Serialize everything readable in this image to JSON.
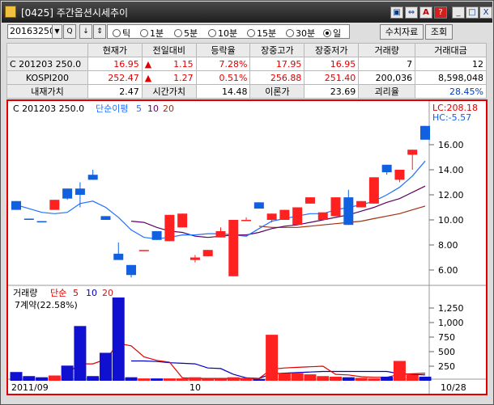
{
  "window": {
    "title": "[0425] 주간옵션시세추이",
    "buttons": [
      "▣",
      "⇔",
      "A",
      "?",
      "_",
      "□",
      "X"
    ]
  },
  "toolbar": {
    "code": "20163250",
    "combo_arrow": "▼",
    "search_icon": "Q",
    "pick_icon": "↓",
    "spin_icon": "⇕",
    "periods": [
      "틱",
      "1분",
      "5분",
      "10분",
      "15분",
      "30분",
      "일"
    ],
    "selected_period": "일",
    "numeric_button": "수치자료",
    "query_button": "조회"
  },
  "info": {
    "headers": [
      "",
      "현재가",
      "전일대비",
      "등락율",
      "장중고가",
      "장중저가",
      "거래량",
      "거래대금"
    ],
    "rows": [
      {
        "name": "C 201203 250.0",
        "price": "16.95",
        "arrow": "▲",
        "change": "1.15",
        "rate": "7.28%",
        "high": "17.95",
        "low": "16.95",
        "volume": "7",
        "amount": "12"
      },
      {
        "name": "KOSPI200",
        "price": "252.47",
        "arrow": "▲",
        "change": "1.27",
        "rate": "0.51%",
        "high": "256.88",
        "low": "251.40",
        "volume": "200,036",
        "amount": "8,598,048"
      }
    ],
    "row3": {
      "l1": "내재가치",
      "v1": "2.47",
      "l2": "시간가치",
      "v2": "14.48",
      "l3": "이론가",
      "v3": "23.69",
      "l4": "괴리율",
      "v4": "28.45%"
    }
  },
  "chart_labels": {
    "price_name": "C 201203 250.0",
    "ma_label": "단순이평",
    "ma5": "5",
    "ma10": "10",
    "ma20": "20",
    "lc": "LC:208.18",
    "hc": "HC:-5.57",
    "vol_label": "거래량",
    "vol_ma_label": "단순",
    "contracts": "7계약(22.58%)",
    "x_start": "2011/09",
    "x_mid": "10",
    "x_end": "10/28"
  },
  "chart_data": {
    "type": "candlestick",
    "y_ticks": [
      "16.00",
      "14.00",
      "12.00",
      "10.00",
      "8.00",
      "6.00"
    ],
    "vol_ticks": [
      "1,250",
      "1,000",
      "750",
      "500",
      "250"
    ],
    "colors": {
      "up": "#ff2020",
      "down": "#1060e0",
      "ma5": "#2070ff",
      "ma10": "#600060",
      "ma20": "#a03010"
    },
    "candles": [
      {
        "o": 11.5,
        "c": 10.8,
        "h": 11.5,
        "l": 10.8
      },
      {
        "o": 10.1,
        "c": 10.0,
        "h": 10.1,
        "l": 10.0
      },
      {
        "o": 9.9,
        "c": 9.8,
        "h": 9.9,
        "l": 9.8
      },
      {
        "o": 10.8,
        "c": 11.6,
        "h": 11.6,
        "l": 10.8
      },
      {
        "o": 12.5,
        "c": 11.7,
        "h": 12.5,
        "l": 11.6
      },
      {
        "o": 12.5,
        "c": 12.0,
        "h": 13.0,
        "l": 11.0
      },
      {
        "o": 13.6,
        "c": 13.2,
        "h": 14.0,
        "l": 13.2
      },
      {
        "o": 10.3,
        "c": 10.0,
        "h": 10.3,
        "l": 10.0
      },
      {
        "o": 7.3,
        "c": 6.8,
        "h": 8.2,
        "l": 6.8
      },
      {
        "o": 6.4,
        "c": 5.6,
        "h": 6.4,
        "l": 5.4
      },
      {
        "o": 7.6,
        "c": 7.6,
        "h": 7.6,
        "l": 7.6
      },
      {
        "o": 9.1,
        "c": 8.4,
        "h": 9.1,
        "l": 8.4
      },
      {
        "o": 8.3,
        "c": 10.4,
        "h": 10.4,
        "l": 8.3
      },
      {
        "o": 9.4,
        "c": 10.5,
        "h": 10.5,
        "l": 9.4
      },
      {
        "o": 6.8,
        "c": 7.0,
        "h": 7.2,
        "l": 6.6
      },
      {
        "o": 7.1,
        "c": 7.6,
        "h": 7.6,
        "l": 7.1
      },
      {
        "o": 8.6,
        "c": 9.1,
        "h": 9.4,
        "l": 8.6
      },
      {
        "o": 5.5,
        "c": 10.0,
        "h": 10.0,
        "l": 5.5
      },
      {
        "o": 10.0,
        "c": 10.0,
        "h": 10.2,
        "l": 10.0
      },
      {
        "o": 11.4,
        "c": 10.9,
        "h": 11.4,
        "l": 10.9
      },
      {
        "o": 10.0,
        "c": 10.5,
        "h": 10.5,
        "l": 9.8
      },
      {
        "o": 10.0,
        "c": 10.8,
        "h": 10.8,
        "l": 10.0
      },
      {
        "o": 9.6,
        "c": 11.0,
        "h": 11.0,
        "l": 9.6
      },
      {
        "o": 11.3,
        "c": 11.8,
        "h": 11.8,
        "l": 11.3
      },
      {
        "o": 10.0,
        "c": 10.6,
        "h": 10.6,
        "l": 10.0
      },
      {
        "o": 10.3,
        "c": 11.8,
        "h": 11.8,
        "l": 10.3
      },
      {
        "o": 11.8,
        "c": 9.6,
        "h": 12.4,
        "l": 9.6
      },
      {
        "o": 11.0,
        "c": 11.5,
        "h": 11.5,
        "l": 11.0
      },
      {
        "o": 11.3,
        "c": 13.4,
        "h": 13.4,
        "l": 11.3
      },
      {
        "o": 14.4,
        "c": 13.8,
        "h": 14.4,
        "l": 13.6
      },
      {
        "o": 13.2,
        "c": 14.0,
        "h": 14.0,
        "l": 13.0
      },
      {
        "o": 15.2,
        "c": 15.6,
        "h": 15.6,
        "l": 14.0
      },
      {
        "o": 17.5,
        "c": 16.4,
        "h": 17.5,
        "l": 16.4
      }
    ],
    "ma5": [
      11.2,
      10.9,
      10.6,
      10.5,
      10.6,
      11.3,
      11.5,
      11.0,
      10.2,
      9.2,
      8.6,
      8.5,
      8.6,
      8.8,
      8.8,
      8.9,
      8.9,
      8.8,
      8.7,
      9.3,
      9.9,
      10.1,
      10.3,
      10.5,
      10.5,
      10.8,
      11.0,
      11.2,
      11.5,
      12.0,
      12.6,
      13.5,
      14.7
    ],
    "ma10": [
      null,
      null,
      null,
      null,
      null,
      null,
      null,
      null,
      null,
      9.9,
      9.8,
      9.4,
      9.1,
      9.0,
      8.7,
      8.6,
      8.7,
      8.8,
      8.8,
      9.0,
      9.3,
      9.5,
      9.6,
      9.8,
      10.0,
      10.2,
      10.4,
      10.7,
      11.0,
      11.4,
      11.7,
      12.2,
      12.7
    ],
    "ma20": [
      null,
      null,
      null,
      null,
      null,
      null,
      null,
      null,
      null,
      null,
      null,
      null,
      null,
      null,
      null,
      null,
      null,
      null,
      null,
      9.5,
      9.4,
      9.4,
      9.4,
      9.5,
      9.6,
      9.7,
      9.8,
      9.9,
      10.1,
      10.3,
      10.5,
      10.8,
      11.1
    ],
    "volume": [
      150,
      80,
      60,
      90,
      260,
      940,
      80,
      480,
      1430,
      60,
      40,
      40,
      40,
      40,
      60,
      30,
      30,
      60,
      50,
      30,
      790,
      130,
      130,
      110,
      80,
      70,
      60,
      50,
      40,
      70,
      340,
      100,
      70
    ],
    "vol_ma5": [
      null,
      null,
      null,
      null,
      130,
      290,
      290,
      370,
      640,
      600,
      410,
      350,
      320,
      50,
      40,
      40,
      40,
      40,
      40,
      40,
      200,
      220,
      230,
      240,
      250,
      110,
      100,
      70,
      60,
      60,
      110,
      120,
      130
    ],
    "vol_ma10": [
      null,
      null,
      null,
      null,
      null,
      null,
      null,
      null,
      null,
      340,
      340,
      330,
      310,
      300,
      290,
      220,
      210,
      110,
      50,
      40,
      120,
      130,
      140,
      150,
      160,
      160,
      160,
      160,
      160,
      160,
      120,
      110,
      100
    ]
  }
}
